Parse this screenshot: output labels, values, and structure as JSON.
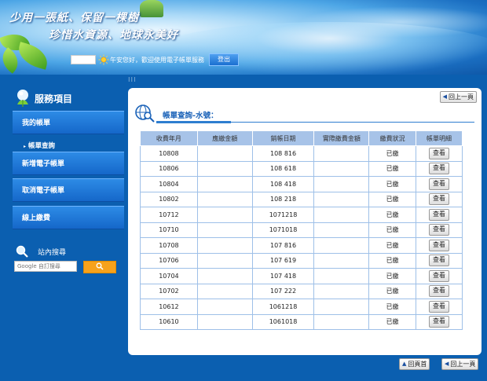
{
  "header": {
    "slogan_line1": "少用一張紙、保留一棵樹",
    "slogan_line2": "珍惜水資源、地球永美好",
    "greeting": "午安您好，歡迎使用電子帳單服務",
    "logout_label": "登出"
  },
  "sidebar": {
    "title": "服務項目",
    "items": [
      {
        "label": "我的帳單"
      },
      {
        "label": "帳單查詢"
      },
      {
        "label": "新增電子帳單"
      },
      {
        "label": "取消電子帳單"
      },
      {
        "label": "線上繳費"
      }
    ],
    "search": {
      "title": "站內搜尋",
      "placeholder": "Google 自訂搜尋"
    }
  },
  "main": {
    "back_label": "回上一頁",
    "home_label": "回頁首",
    "title": "帳單查詢-水號：",
    "table": {
      "headers": [
        "收費年月",
        "應繳金額",
        "銷帳日期",
        "實際繳費金額",
        "繳費狀況",
        "帳單明細"
      ],
      "rows": [
        {
          "ym": "10808",
          "amount": "",
          "date": "108 816",
          "actual": "",
          "status": "已繳",
          "detail": "查看"
        },
        {
          "ym": "10806",
          "amount": "",
          "date": "108 618",
          "actual": "",
          "status": "已繳",
          "detail": "查看"
        },
        {
          "ym": "10804",
          "amount": "",
          "date": "108 418",
          "actual": "",
          "status": "已繳",
          "detail": "查看"
        },
        {
          "ym": "10802",
          "amount": "",
          "date": "108 218",
          "actual": "",
          "status": "已繳",
          "detail": "查看"
        },
        {
          "ym": "10712",
          "amount": "",
          "date": "1071218",
          "actual": "",
          "status": "已繳",
          "detail": "查看"
        },
        {
          "ym": "10710",
          "amount": "",
          "date": "1071018",
          "actual": "",
          "status": "已繳",
          "detail": "查看"
        },
        {
          "ym": "10708",
          "amount": "",
          "date": "107 816",
          "actual": "",
          "status": "已繳",
          "detail": "查看"
        },
        {
          "ym": "10706",
          "amount": "",
          "date": "107 619",
          "actual": "",
          "status": "已繳",
          "detail": "查看"
        },
        {
          "ym": "10704",
          "amount": "",
          "date": "107 418",
          "actual": "",
          "status": "已繳",
          "detail": "查看"
        },
        {
          "ym": "10702",
          "amount": "",
          "date": "107 222",
          "actual": "",
          "status": "已繳",
          "detail": "查看"
        },
        {
          "ym": "10612",
          "amount": "",
          "date": "1061218",
          "actual": "",
          "status": "已繳",
          "detail": "查看"
        },
        {
          "ym": "10610",
          "amount": "",
          "date": "1061018",
          "actual": "",
          "status": "已繳",
          "detail": "查看"
        }
      ]
    }
  },
  "colors": {
    "page_bg": "#0b5fb0",
    "menu_button": "#1e78d8",
    "table_header": "#a7c3e8",
    "title_blue": "#1a62b8",
    "search_button": "#f7a21b"
  },
  "icons": [
    "sun-icon",
    "service-icon",
    "magnifier-icon",
    "search-icon",
    "globe-search-icon",
    "arrow-left-icon",
    "arrow-up-icon"
  ]
}
